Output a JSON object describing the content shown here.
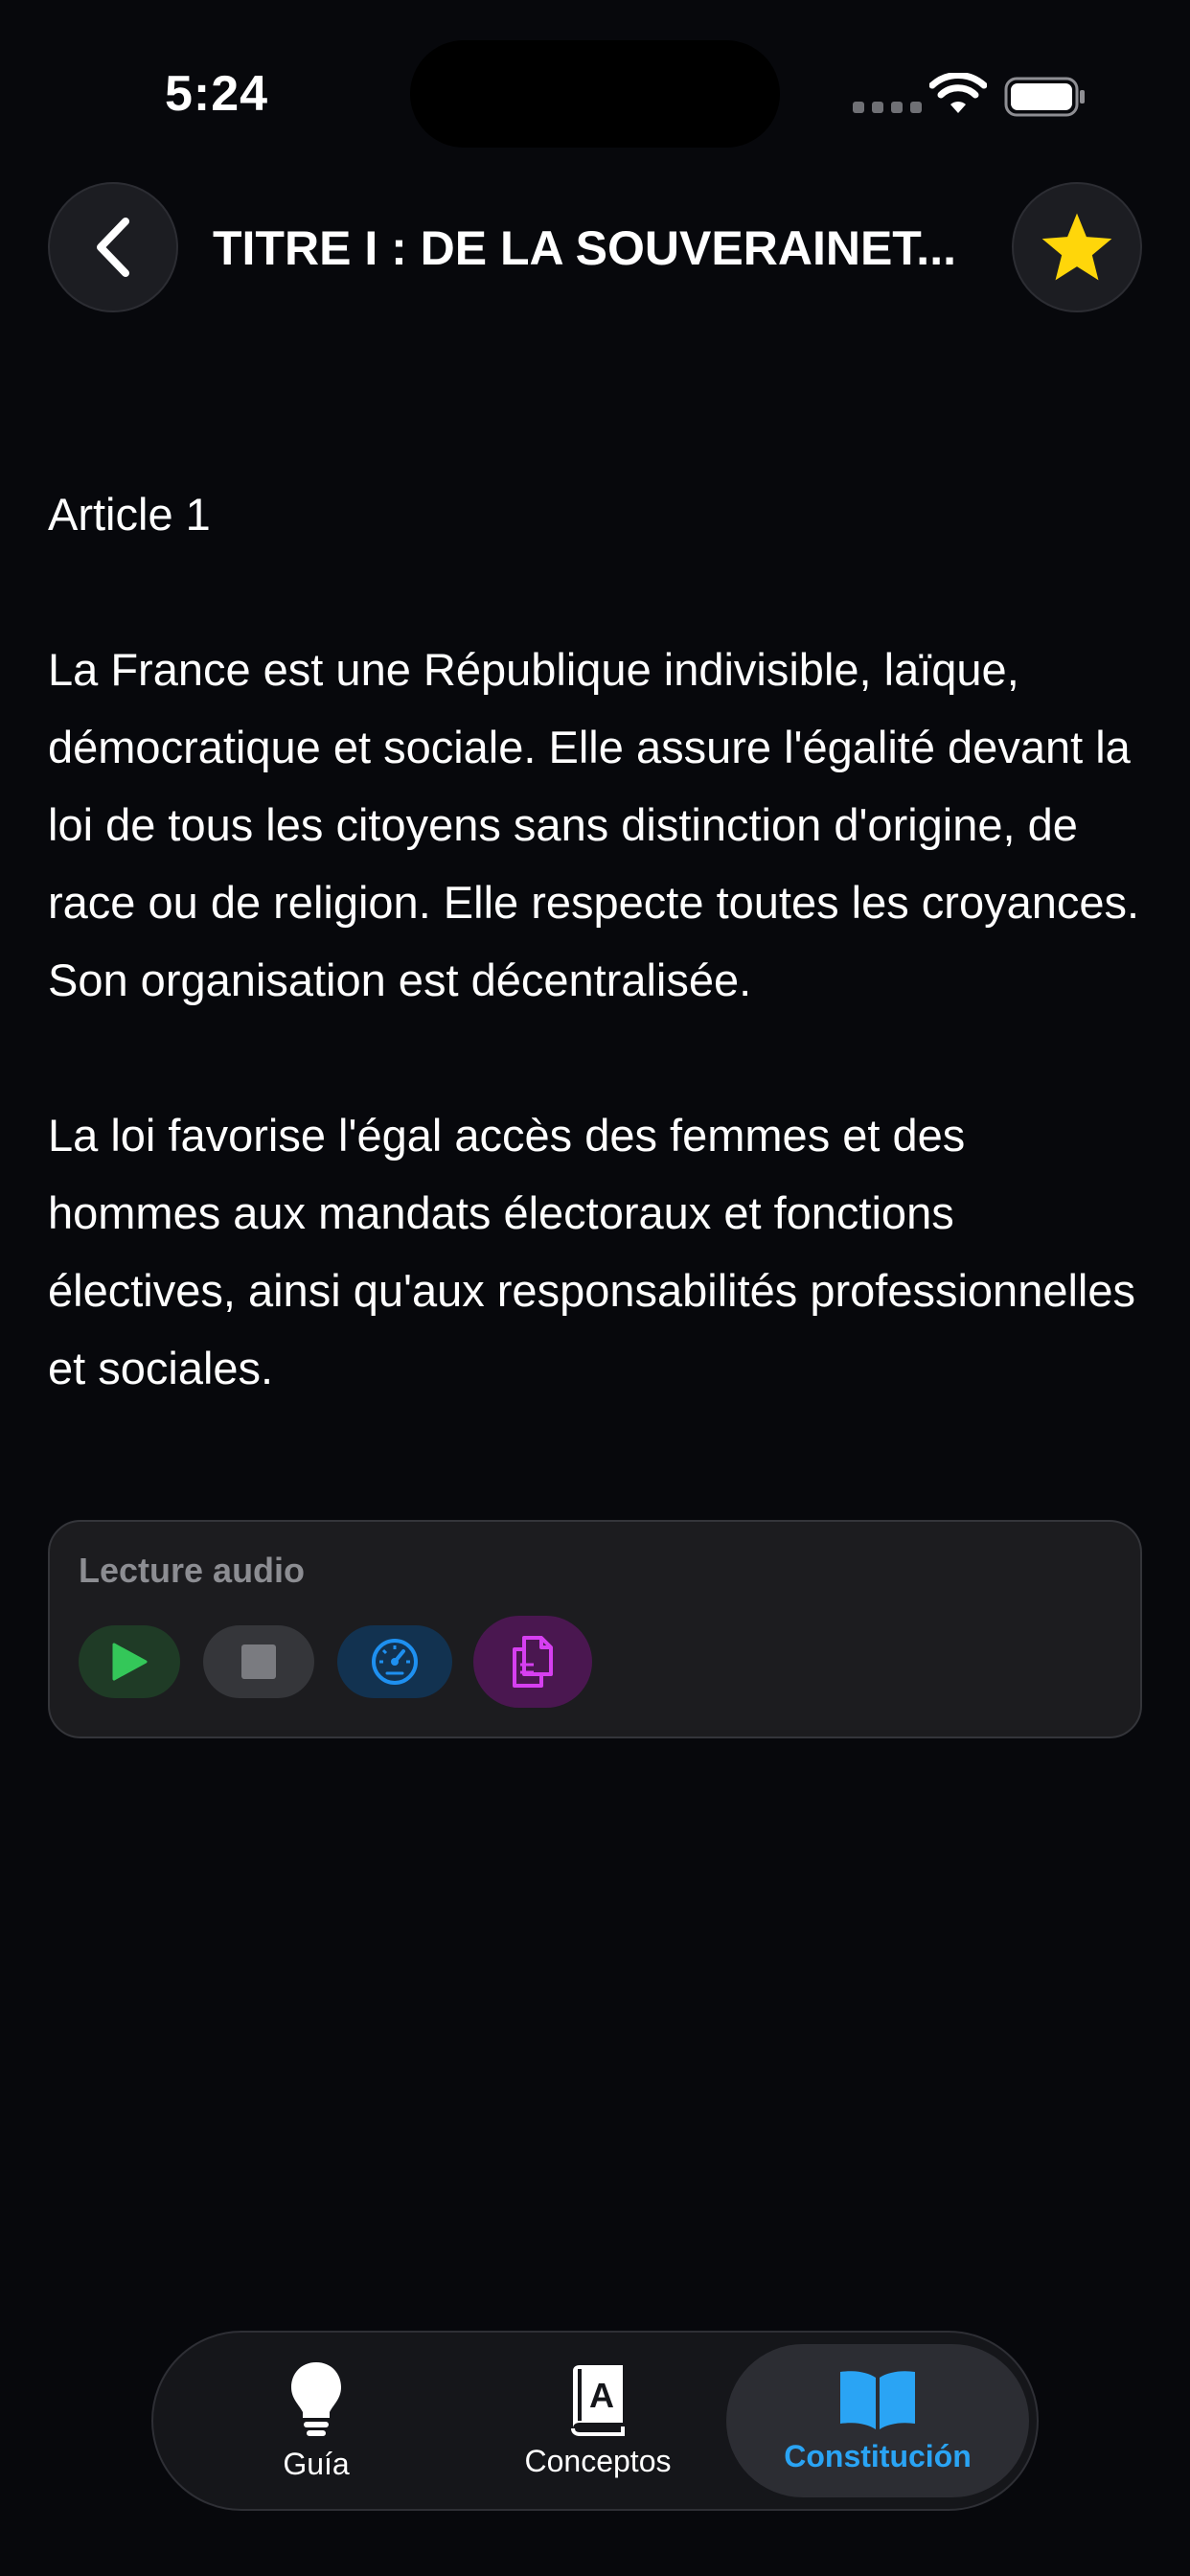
{
  "status_bar": {
    "time": "5:24"
  },
  "header": {
    "title": "TITRE I : DE LA SOUVERAINET..."
  },
  "article": {
    "heading": "Article 1",
    "paragraphs": [
      "La France est une République indivisible, laïque, démocratique et sociale. Elle assure l'égalité devant la loi de tous les citoyens sans distinction d'origine, de race ou de religion. Elle respecte toutes les croyances. Son organisation est décentralisée.",
      "La loi favorise l'égal accès des femmes et des hommes aux mandats électoraux et fonctions électives, ainsi qu'aux responsabilités professionnelles et sociales."
    ]
  },
  "audio": {
    "label": "Lecture audio",
    "buttons": [
      "play-icon",
      "stop-icon",
      "speedometer-icon",
      "copy-icon"
    ]
  },
  "tabbar": {
    "items": [
      {
        "label": "Guía",
        "icon": "lightbulb-icon"
      },
      {
        "label": "Conceptos",
        "icon": "dictionary-icon"
      },
      {
        "label": "Constitución",
        "icon": "book-icon"
      }
    ],
    "active_index": 2
  },
  "colors": {
    "background": "#07080c",
    "accent": "#2aa4f4",
    "star": "#ffd60a",
    "play": "#34c759",
    "copy": "#d63ff0"
  }
}
